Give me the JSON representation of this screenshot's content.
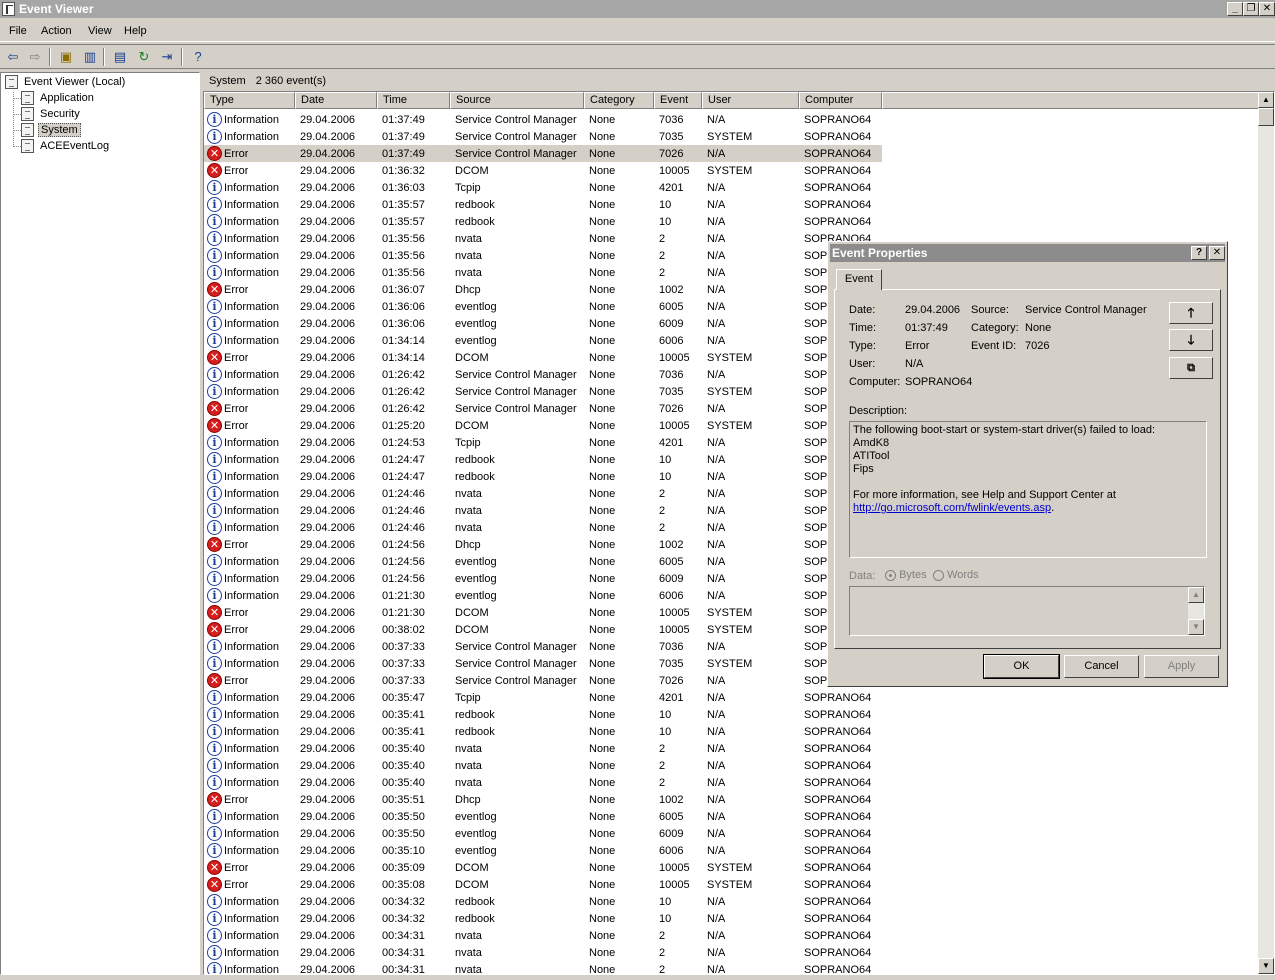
{
  "window": {
    "title": "Event Viewer"
  },
  "menu": [
    "File",
    "Action",
    "View",
    "Help"
  ],
  "tree": {
    "root": "Event Viewer (Local)",
    "items": [
      "Application",
      "Security",
      "System",
      "ACEEventLog"
    ],
    "selected": "System"
  },
  "panel": {
    "name": "System",
    "count": "2 360 event(s)"
  },
  "columns": [
    "Type",
    "Date",
    "Time",
    "Source",
    "Category",
    "Event",
    "User",
    "Computer"
  ],
  "rows": [
    [
      "Information",
      "29.04.2006",
      "01:37:49",
      "Service Control Manager",
      "None",
      "7036",
      "N/A",
      "SOPRANO64"
    ],
    [
      "Information",
      "29.04.2006",
      "01:37:49",
      "Service Control Manager",
      "None",
      "7035",
      "SYSTEM",
      "SOPRANO64"
    ],
    [
      "Error",
      "29.04.2006",
      "01:37:49",
      "Service Control Manager",
      "None",
      "7026",
      "N/A",
      "SOPRANO64"
    ],
    [
      "Error",
      "29.04.2006",
      "01:36:32",
      "DCOM",
      "None",
      "10005",
      "SYSTEM",
      "SOPRANO64"
    ],
    [
      "Information",
      "29.04.2006",
      "01:36:03",
      "Tcpip",
      "None",
      "4201",
      "N/A",
      "SOPRANO64"
    ],
    [
      "Information",
      "29.04.2006",
      "01:35:57",
      "redbook",
      "None",
      "10",
      "N/A",
      "SOPRANO64"
    ],
    [
      "Information",
      "29.04.2006",
      "01:35:57",
      "redbook",
      "None",
      "10",
      "N/A",
      "SOPRANO64"
    ],
    [
      "Information",
      "29.04.2006",
      "01:35:56",
      "nvata",
      "None",
      "2",
      "N/A",
      "SOPRANO64"
    ],
    [
      "Information",
      "29.04.2006",
      "01:35:56",
      "nvata",
      "None",
      "2",
      "N/A",
      "SOP"
    ],
    [
      "Information",
      "29.04.2006",
      "01:35:56",
      "nvata",
      "None",
      "2",
      "N/A",
      "SOP"
    ],
    [
      "Error",
      "29.04.2006",
      "01:36:07",
      "Dhcp",
      "None",
      "1002",
      "N/A",
      "SOP"
    ],
    [
      "Information",
      "29.04.2006",
      "01:36:06",
      "eventlog",
      "None",
      "6005",
      "N/A",
      "SOP"
    ],
    [
      "Information",
      "29.04.2006",
      "01:36:06",
      "eventlog",
      "None",
      "6009",
      "N/A",
      "SOP"
    ],
    [
      "Information",
      "29.04.2006",
      "01:34:14",
      "eventlog",
      "None",
      "6006",
      "N/A",
      "SOP"
    ],
    [
      "Error",
      "29.04.2006",
      "01:34:14",
      "DCOM",
      "None",
      "10005",
      "SYSTEM",
      "SOP"
    ],
    [
      "Information",
      "29.04.2006",
      "01:26:42",
      "Service Control Manager",
      "None",
      "7036",
      "N/A",
      "SOP"
    ],
    [
      "Information",
      "29.04.2006",
      "01:26:42",
      "Service Control Manager",
      "None",
      "7035",
      "SYSTEM",
      "SOP"
    ],
    [
      "Error",
      "29.04.2006",
      "01:26:42",
      "Service Control Manager",
      "None",
      "7026",
      "N/A",
      "SOP"
    ],
    [
      "Error",
      "29.04.2006",
      "01:25:20",
      "DCOM",
      "None",
      "10005",
      "SYSTEM",
      "SOP"
    ],
    [
      "Information",
      "29.04.2006",
      "01:24:53",
      "Tcpip",
      "None",
      "4201",
      "N/A",
      "SOP"
    ],
    [
      "Information",
      "29.04.2006",
      "01:24:47",
      "redbook",
      "None",
      "10",
      "N/A",
      "SOP"
    ],
    [
      "Information",
      "29.04.2006",
      "01:24:47",
      "redbook",
      "None",
      "10",
      "N/A",
      "SOP"
    ],
    [
      "Information",
      "29.04.2006",
      "01:24:46",
      "nvata",
      "None",
      "2",
      "N/A",
      "SOP"
    ],
    [
      "Information",
      "29.04.2006",
      "01:24:46",
      "nvata",
      "None",
      "2",
      "N/A",
      "SOP"
    ],
    [
      "Information",
      "29.04.2006",
      "01:24:46",
      "nvata",
      "None",
      "2",
      "N/A",
      "SOP"
    ],
    [
      "Error",
      "29.04.2006",
      "01:24:56",
      "Dhcp",
      "None",
      "1002",
      "N/A",
      "SOP"
    ],
    [
      "Information",
      "29.04.2006",
      "01:24:56",
      "eventlog",
      "None",
      "6005",
      "N/A",
      "SOP"
    ],
    [
      "Information",
      "29.04.2006",
      "01:24:56",
      "eventlog",
      "None",
      "6009",
      "N/A",
      "SOP"
    ],
    [
      "Information",
      "29.04.2006",
      "01:21:30",
      "eventlog",
      "None",
      "6006",
      "N/A",
      "SOP"
    ],
    [
      "Error",
      "29.04.2006",
      "01:21:30",
      "DCOM",
      "None",
      "10005",
      "SYSTEM",
      "SOP"
    ],
    [
      "Error",
      "29.04.2006",
      "00:38:02",
      "DCOM",
      "None",
      "10005",
      "SYSTEM",
      "SOP"
    ],
    [
      "Information",
      "29.04.2006",
      "00:37:33",
      "Service Control Manager",
      "None",
      "7036",
      "N/A",
      "SOP"
    ],
    [
      "Information",
      "29.04.2006",
      "00:37:33",
      "Service Control Manager",
      "None",
      "7035",
      "SYSTEM",
      "SOP"
    ],
    [
      "Error",
      "29.04.2006",
      "00:37:33",
      "Service Control Manager",
      "None",
      "7026",
      "N/A",
      "SOP"
    ],
    [
      "Information",
      "29.04.2006",
      "00:35:47",
      "Tcpip",
      "None",
      "4201",
      "N/A",
      "SOPRANO64"
    ],
    [
      "Information",
      "29.04.2006",
      "00:35:41",
      "redbook",
      "None",
      "10",
      "N/A",
      "SOPRANO64"
    ],
    [
      "Information",
      "29.04.2006",
      "00:35:41",
      "redbook",
      "None",
      "10",
      "N/A",
      "SOPRANO64"
    ],
    [
      "Information",
      "29.04.2006",
      "00:35:40",
      "nvata",
      "None",
      "2",
      "N/A",
      "SOPRANO64"
    ],
    [
      "Information",
      "29.04.2006",
      "00:35:40",
      "nvata",
      "None",
      "2",
      "N/A",
      "SOPRANO64"
    ],
    [
      "Information",
      "29.04.2006",
      "00:35:40",
      "nvata",
      "None",
      "2",
      "N/A",
      "SOPRANO64"
    ],
    [
      "Error",
      "29.04.2006",
      "00:35:51",
      "Dhcp",
      "None",
      "1002",
      "N/A",
      "SOPRANO64"
    ],
    [
      "Information",
      "29.04.2006",
      "00:35:50",
      "eventlog",
      "None",
      "6005",
      "N/A",
      "SOPRANO64"
    ],
    [
      "Information",
      "29.04.2006",
      "00:35:50",
      "eventlog",
      "None",
      "6009",
      "N/A",
      "SOPRANO64"
    ],
    [
      "Information",
      "29.04.2006",
      "00:35:10",
      "eventlog",
      "None",
      "6006",
      "N/A",
      "SOPRANO64"
    ],
    [
      "Error",
      "29.04.2006",
      "00:35:09",
      "DCOM",
      "None",
      "10005",
      "SYSTEM",
      "SOPRANO64"
    ],
    [
      "Error",
      "29.04.2006",
      "00:35:08",
      "DCOM",
      "None",
      "10005",
      "SYSTEM",
      "SOPRANO64"
    ],
    [
      "Information",
      "29.04.2006",
      "00:34:32",
      "redbook",
      "None",
      "10",
      "N/A",
      "SOPRANO64"
    ],
    [
      "Information",
      "29.04.2006",
      "00:34:32",
      "redbook",
      "None",
      "10",
      "N/A",
      "SOPRANO64"
    ],
    [
      "Information",
      "29.04.2006",
      "00:34:31",
      "nvata",
      "None",
      "2",
      "N/A",
      "SOPRANO64"
    ],
    [
      "Information",
      "29.04.2006",
      "00:34:31",
      "nvata",
      "None",
      "2",
      "N/A",
      "SOPRANO64"
    ],
    [
      "Information",
      "29.04.2006",
      "00:34:31",
      "nvata",
      "None",
      "2",
      "N/A",
      "SOPRANO64"
    ]
  ],
  "selected_row": 2,
  "dialog": {
    "title": "Event Properties",
    "tab": "Event",
    "labels": {
      "date": "Date:",
      "source": "Source:",
      "time": "Time:",
      "category": "Category:",
      "type": "Type:",
      "event_id": "Event ID:",
      "user": "User:",
      "computer": "Computer:",
      "description": "Description:",
      "data": "Data:",
      "bytes": "Bytes",
      "words": "Words"
    },
    "values": {
      "date": "29.04.2006",
      "source": "Service Control Manager",
      "time": "01:37:49",
      "category": "None",
      "type": "Error",
      "event_id": "7026",
      "user": "N/A",
      "computer": "SOPRANO64"
    },
    "description_lines": [
      "The following boot-start or system-start driver(s) failed to load:",
      "AmdK8",
      "ATITool",
      "Fips",
      "",
      "For more information, see Help and Support Center at"
    ],
    "description_link": "http://go.microsoft.com/fwlink/events.asp",
    "description_link_tail": ".",
    "buttons": {
      "ok": "OK",
      "cancel": "Cancel",
      "apply": "Apply"
    }
  }
}
